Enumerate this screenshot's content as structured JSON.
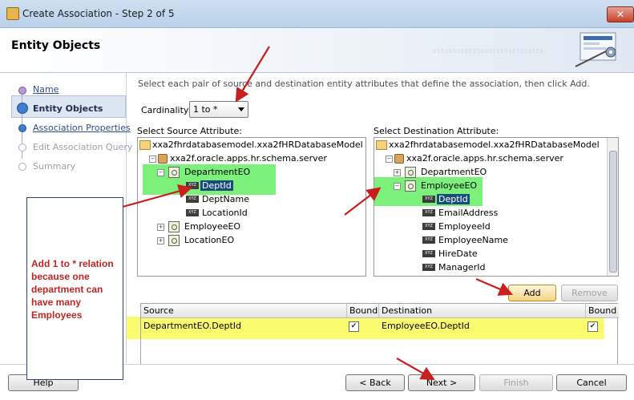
{
  "window": {
    "title": "Create Association - Step 2 of 5",
    "close_label": "✕"
  },
  "header": {
    "title": "Entity Objects",
    "binary": "0101010101010101010101010101"
  },
  "steps": [
    {
      "label": "Name",
      "state": "link"
    },
    {
      "label": "Entity Objects",
      "state": "current"
    },
    {
      "label": "Association Properties",
      "state": "link"
    },
    {
      "label": "Edit Association Query",
      "state": "disabled"
    },
    {
      "label": "Summary",
      "state": "disabled"
    }
  ],
  "instructions": "Select each pair of source and destination entity attributes that define the association, then click Add.",
  "cardinality": {
    "label": "Cardinality:",
    "value": "1 to *"
  },
  "source": {
    "label": "Select Source Attribute:",
    "root": "xxa2fhrdatabasemodel.xxa2fHRDatabaseModel",
    "pkg": "xxa2f.oracle.apps.hr.schema.server",
    "eos": [
      "DepartmentEO",
      "EmployeeEO",
      "LocationEO"
    ],
    "attrs": [
      "DeptId",
      "DeptName",
      "LocationId"
    ]
  },
  "destination": {
    "label": "Select Destination Attribute:",
    "root": "xxa2fhrdatabasemodel.xxa2fHRDatabaseModel",
    "pkg": "xxa2f.oracle.apps.hr.schema.server",
    "eos": [
      "DepartmentEO",
      "EmployeeEO"
    ],
    "attrs": [
      "DeptId",
      "EmailAddress",
      "EmployeeId",
      "EmployeeName",
      "HireDate",
      "ManagerId"
    ]
  },
  "buttons": {
    "add": "Add",
    "remove": "Remove",
    "help": "Help",
    "back": "< Back",
    "next": "Next >",
    "finish": "Finish",
    "cancel": "Cancel"
  },
  "table": {
    "headers": [
      "Source",
      "Bound",
      "Destination",
      "Bound"
    ],
    "rows": [
      {
        "source": "DepartmentEO.DeptId",
        "source_bound": "✔",
        "destination": "EmployeeEO.DeptId",
        "dest_bound": "✔"
      }
    ]
  },
  "note": "Add 1 to * relation because one department can have many Employees",
  "colors": {
    "highlight_green": "#7bf07b",
    "highlight_yellow": "#fbfb6f",
    "arrow_red": "#c81e1e",
    "note_text": "#c02424"
  }
}
